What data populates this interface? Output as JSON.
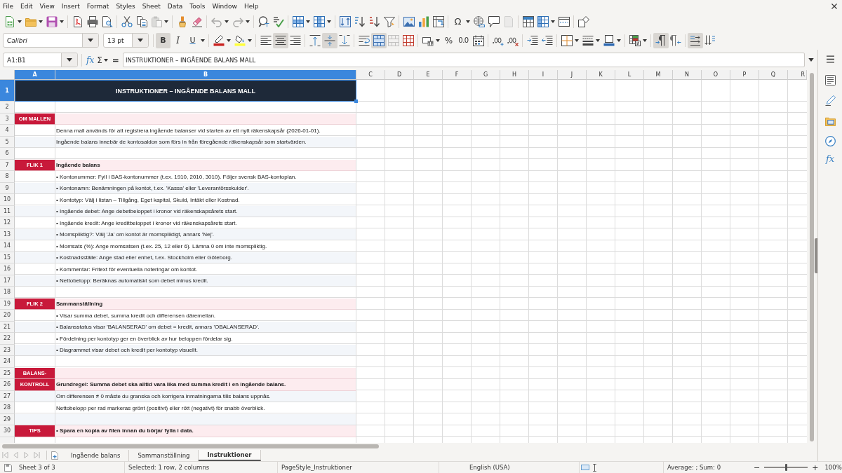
{
  "menu_bar": {
    "items": [
      "File",
      "Edit",
      "View",
      "Insert",
      "Format",
      "Styles",
      "Sheet",
      "Data",
      "Tools",
      "Window",
      "Help"
    ]
  },
  "standard_toolbar": {
    "paste": {
      "disabled": true
    },
    "undo": {
      "disabled": true
    },
    "redo": {
      "disabled": true
    },
    "special_character": {
      "label": "Ω"
    },
    "headers_footers": {
      "disabled": true
    }
  },
  "formatting_toolbar": {
    "font_name": "Calibri",
    "font_size": "13 pt",
    "bold": {
      "label": "B",
      "selected": true
    },
    "italic": {
      "label": "I",
      "selected": false
    },
    "underline": {
      "label": "U",
      "selected": false
    },
    "align_left": {
      "selected": false
    },
    "align_center": {
      "selected": true
    },
    "align_right": {
      "selected": false
    },
    "align_top": {
      "selected": false
    },
    "align_middle": {
      "selected": true
    },
    "align_bottom": {
      "selected": false
    },
    "merge_and_center": {
      "selected": true
    },
    "merge_cells": {
      "disabled": true
    },
    "percent": {
      "label": "%"
    },
    "number_format": {
      "label": "0.0"
    },
    "paragraph_left_to_right": {
      "selected": true
    },
    "paragraph_right_to_left": {
      "selected": false
    },
    "text_horizontal": {
      "selected": true
    },
    "text_vertical": {
      "selected": false
    }
  },
  "formula_bar": {
    "name_box": "A1:B1",
    "function_wizard": "fx",
    "sum": "Σ",
    "formula": "=",
    "content": "INSTRUKTIONER – INGÅENDE BALANS MALL"
  },
  "sidebar": {
    "functions": "fx"
  },
  "sheet": {
    "columns": [
      {
        "label": "A",
        "selected": true
      },
      {
        "label": "B",
        "selected": true
      },
      {
        "label": "C",
        "selected": false
      },
      {
        "label": "D",
        "selected": false
      },
      {
        "label": "E",
        "selected": false
      },
      {
        "label": "F",
        "selected": false
      },
      {
        "label": "G",
        "selected": false
      },
      {
        "label": "H",
        "selected": false
      },
      {
        "label": "I",
        "selected": false
      },
      {
        "label": "J",
        "selected": false
      },
      {
        "label": "K",
        "selected": false
      },
      {
        "label": "L",
        "selected": false
      },
      {
        "label": "M",
        "selected": false
      },
      {
        "label": "N",
        "selected": false
      },
      {
        "label": "O",
        "selected": false
      },
      {
        "label": "P",
        "selected": false
      },
      {
        "label": "Q",
        "selected": false
      },
      {
        "label": "R",
        "selected": false
      }
    ],
    "rows": [
      {
        "number": "1",
        "selected": true,
        "kind": "title",
        "text": "INSTRUKTIONER – INGÅENDE BALANS MALL"
      },
      {
        "number": "2",
        "selected": false,
        "kind": "blank"
      },
      {
        "number": "3",
        "selected": false,
        "kind": "section",
        "label": "OM MALLEN"
      },
      {
        "number": "4",
        "selected": false,
        "kind": "plain",
        "shaded": false,
        "text": "Denna mall används för att registrera ingående balanser vid starten av ett nytt räkenskapsår (2026-01-01)."
      },
      {
        "number": "5",
        "selected": false,
        "kind": "plain",
        "shaded": true,
        "text": "Ingående balans innebär de kontosaldon som förs in från föregående räkenskapsår som startvärden."
      },
      {
        "number": "6",
        "selected": false,
        "kind": "blank"
      },
      {
        "number": "7",
        "selected": false,
        "kind": "section",
        "label": "FLIK 1",
        "text": "Ingående balans"
      },
      {
        "number": "8",
        "selected": false,
        "kind": "plain",
        "shaded": false,
        "text": "• Kontonummer: Fyll i BAS-kontonummer (t.ex. 1910, 2010, 3010). Följer svensk BAS-kontoplan."
      },
      {
        "number": "9",
        "selected": false,
        "kind": "plain",
        "shaded": true,
        "text": "• Kontonamn: Benämningen på kontot, t.ex. 'Kassa' eller 'Leverantörsskulder'."
      },
      {
        "number": "10",
        "selected": false,
        "kind": "plain",
        "shaded": false,
        "text": "• Kontotyp: Välj i listan – Tillgång, Eget kapital, Skuld, Intäkt eller Kostnad."
      },
      {
        "number": "11",
        "selected": false,
        "kind": "plain",
        "shaded": true,
        "text": "• Ingående debet: Ange debetbeloppet i kronor vid räkenskapsårets start."
      },
      {
        "number": "12",
        "selected": false,
        "kind": "plain",
        "shaded": false,
        "text": "• Ingående kredit: Ange kreditbeloppet i kronor vid räkenskapsårets start."
      },
      {
        "number": "13",
        "selected": false,
        "kind": "plain",
        "shaded": true,
        "text": "• Momspliktig?: Välj 'Ja' om kontot är momspliktigt, annars 'Nej'."
      },
      {
        "number": "14",
        "selected": false,
        "kind": "plain",
        "shaded": false,
        "text": "• Momsats (%): Ange momsatsen (t.ex. 25, 12 eller 6). Lämna 0 om inte momspliktig."
      },
      {
        "number": "15",
        "selected": false,
        "kind": "plain",
        "shaded": true,
        "text": "• Kostnadsställe: Ange stad eller enhet, t.ex. Stockholm eller Göteborg."
      },
      {
        "number": "16",
        "selected": false,
        "kind": "plain",
        "shaded": false,
        "text": "• Kommentar: Fritext för eventuella noteringar om kontot."
      },
      {
        "number": "17",
        "selected": false,
        "kind": "plain",
        "shaded": true,
        "text": "• Nettobelopp: Beräknas automatiskt som debet minus kredit."
      },
      {
        "number": "18",
        "selected": false,
        "kind": "blank"
      },
      {
        "number": "19",
        "selected": false,
        "kind": "section",
        "label": "FLIK 2",
        "text": "Sammanställning"
      },
      {
        "number": "20",
        "selected": false,
        "kind": "plain",
        "shaded": false,
        "text": "• Visar summa debet, summa kredit och differensen däremellan."
      },
      {
        "number": "21",
        "selected": false,
        "kind": "plain",
        "shaded": true,
        "text": "• Balansstatus visar 'BALANSERAD' om debet = kredit, annars 'OBALANSERAD'."
      },
      {
        "number": "22",
        "selected": false,
        "kind": "plain",
        "shaded": false,
        "text": "• Fördelning per kontotyp ger en överblick av hur beloppen fördelar sig."
      },
      {
        "number": "23",
        "selected": false,
        "kind": "plain",
        "shaded": true,
        "text": "• Diagrammet visar debet och kredit per kontotyp visuellt."
      },
      {
        "number": "24",
        "selected": false,
        "kind": "blank"
      },
      {
        "number": "25",
        "selected": false,
        "kind": "section",
        "label": "BALANS-"
      },
      {
        "number": "26",
        "selected": false,
        "kind": "section",
        "label": "KONTROLL",
        "text": "Grundregel: Summa debet ska alltid vara lika med summa kredit i en ingående balans."
      },
      {
        "number": "27",
        "selected": false,
        "kind": "plain",
        "shaded": true,
        "text": "Om differensen ≠ 0 måste du granska och korrigera inmatningarna tills balans uppnås."
      },
      {
        "number": "28",
        "selected": false,
        "kind": "plain",
        "shaded": false,
        "text": "Nettobelopp per rad markeras grönt (positivt) eller rött (negativt) för snabb överblick."
      },
      {
        "number": "29",
        "selected": false,
        "kind": "blank",
        "shaded": true
      },
      {
        "number": "30",
        "selected": false,
        "kind": "section",
        "label": "TIPS",
        "text": "• Spara en kopia av filen innan du börjar fylla i data."
      }
    ]
  },
  "sheet_tabs": {
    "navigation_disabled": true,
    "tabs": [
      {
        "label": "Ingående balans",
        "selected": false
      },
      {
        "label": "Sammanställning",
        "selected": false
      },
      {
        "label": "Instruktioner",
        "selected": true
      }
    ]
  },
  "status_bar": {
    "sheet": "Sheet 3 of 3",
    "selection": "Selected: 1 row, 2 columns",
    "page_style": "PageStyle_Instruktioner",
    "language": "English (USA)",
    "summary": "Average: ; Sum: 0",
    "zoom_out": "−",
    "zoom": {
      "level": 0.5
    },
    "zoom_in": "+",
    "zoom_reading": "100%"
  }
}
